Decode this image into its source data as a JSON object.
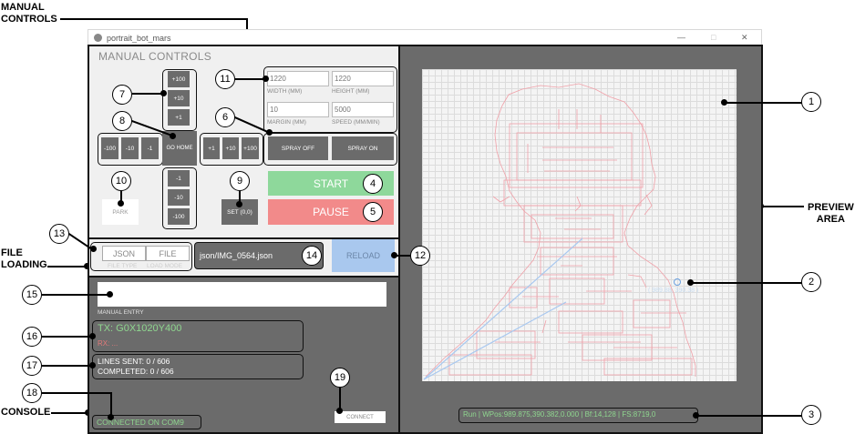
{
  "callouts": {
    "manual_controls": "MANUAL\nCONTROLS",
    "file_loading": "FILE\nLOADING",
    "console": "CONSOLE",
    "preview_area": "PREVIEW\nAREA"
  },
  "window": {
    "title": "portrait_bot_mars",
    "minimize": "—",
    "maximize": "□",
    "close": "✕"
  },
  "manual": {
    "header": "MANUAL CONTROLS",
    "y_plus": [
      "+100",
      "+10",
      "+1"
    ],
    "y_minus": [
      "-1",
      "-10",
      "-100"
    ],
    "x_minus": [
      "-100",
      "-10",
      "-1"
    ],
    "x_plus": [
      "+1",
      "+10",
      "+100"
    ],
    "go_home": "GO HOME",
    "park": "PARK",
    "set_origin": "SET (0,0)",
    "width_value": "1220",
    "width_label": "WIDTH (MM)",
    "height_value": "1220",
    "height_label": "HEIGHT (MM)",
    "margin_value": "10",
    "margin_label": "MARGIN (MM)",
    "speed_value": "5000",
    "speed_label": "SPEED (MM/MIN)",
    "spray_off": "SPRAY OFF",
    "spray_on": "SPRAY ON",
    "start": "START",
    "pause": "PAUSE"
  },
  "file": {
    "file_type_value": "JSON",
    "file_type_label": "FILE TYPE",
    "load_mode_value": "FILE",
    "load_mode_label": "LOAD MODE",
    "path": "json/IMG_0564.json",
    "reload": "RELOAD"
  },
  "console": {
    "manual_entry_label": "MANUAL ENTRY",
    "tx": "TX: G0X1020Y400",
    "rx": "RX: ...",
    "lines_sent": "LINES SENT: 0 / 606",
    "completed": "COMPLETED: 0 / 606",
    "connect": "CONNECT",
    "connection_status": "CONNECTED ON COM9"
  },
  "preview": {
    "position_label": "( 989.88, 390.38 )",
    "status_bar": "Run | WPos:989.875,390.382,0.000 | Bf:14,128 | FS:8719,0"
  },
  "colors": {
    "start": "#8ed89b",
    "pause": "#f28a8a",
    "reload": "#a9c8ee",
    "console_green": "#8fd68f",
    "rx_red": "#e37a7a",
    "drawing": "#f0a0a8",
    "cable": "#a8c8f0"
  },
  "numbers": [
    "1",
    "2",
    "3",
    "4",
    "5",
    "6",
    "7",
    "8",
    "9",
    "10",
    "11",
    "12",
    "13",
    "14",
    "15",
    "16",
    "17",
    "18",
    "19"
  ]
}
